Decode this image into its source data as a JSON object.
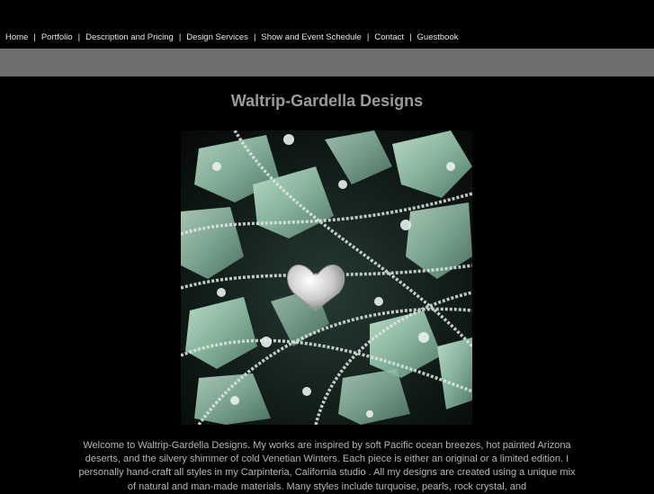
{
  "nav": {
    "items": [
      "Home",
      "Portfolio",
      "Description and Pricing",
      "Design Services",
      "Show and Event Schedule",
      "Contact",
      "Guestbook"
    ],
    "separator": "|"
  },
  "header": {
    "title": "Waltrip-Gardella Designs"
  },
  "main": {
    "intro_text": "Welcome to Waltrip-Gardella Designs. My works are inspired by soft Pacific ocean breezes, hot painted Arizona deserts, and the silvery shimmer of cold Venetian Winters. Each piece is either an original or a limited edition. I personally hand-craft all styles in my Carpinteria, California studio . All my designs are created using a unique mix of natural and man-made materials. Many styles include turquoise, pearls, rock crystal, and"
  },
  "colors": {
    "background": "#000000",
    "nav_bar": "#6f6f6f",
    "title": "#9a9a9a",
    "stone": "#8fb8a4"
  }
}
